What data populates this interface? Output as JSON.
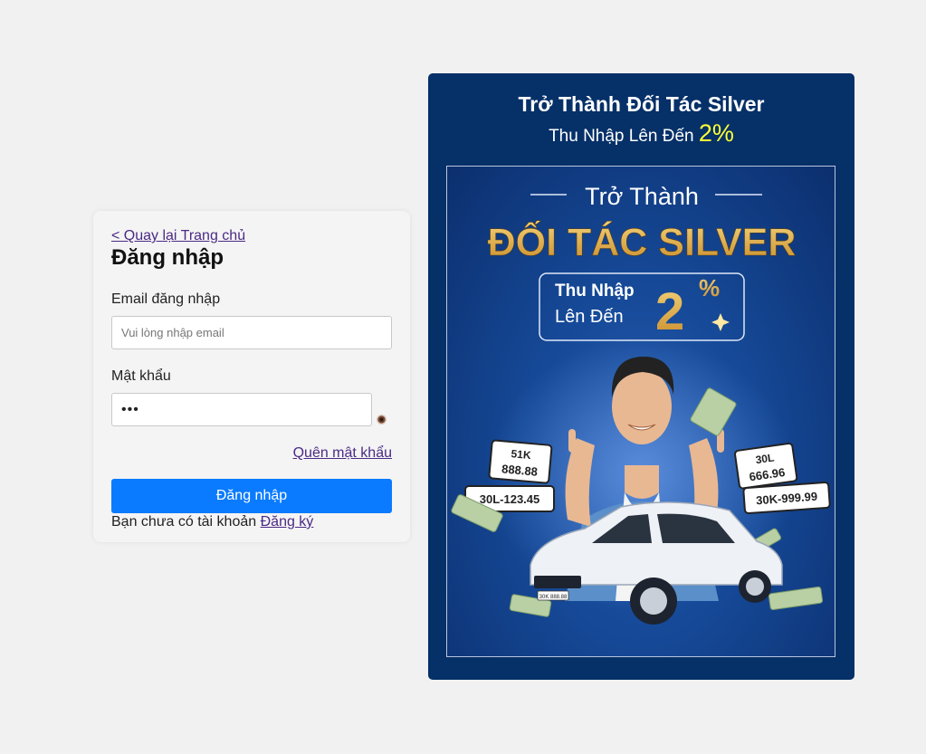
{
  "login": {
    "back_link": "< Quay lại Trang chủ",
    "title": "Đăng nhập",
    "email_label": "Email đăng nhập",
    "email_placeholder": "Vui lòng nhập email",
    "password_label": "Mật khẩu",
    "password_value": "•••",
    "forgot_link": "Quên mật khẩu",
    "submit_label": "Đăng nhập",
    "signup_prompt": "Bạn chưa có tài khoản",
    "signup_link": "Đăng ký"
  },
  "promo": {
    "title": "Trở Thành Đối Tác Silver",
    "subtitle_prefix": "Thu Nhập Lên Đến",
    "subtitle_percent": "2%",
    "banner": {
      "heading_small": "Trở Thành",
      "heading_large": "ĐỐI TÁC SILVER",
      "income_line1": "Thu Nhập",
      "income_line2": "Lên Đến",
      "income_value": "2",
      "income_unit": "%",
      "plates": [
        "51K",
        "888.88",
        "30L-123.45",
        "30L",
        "666.96",
        "30K-999.99",
        "30K 888.88"
      ]
    }
  },
  "colors": {
    "background": "#f1f1f1",
    "panel": "#063068",
    "accent": "#ffff33",
    "button": "#0a7bff",
    "link": "#4b2a86",
    "gold": "#e0b04a"
  }
}
